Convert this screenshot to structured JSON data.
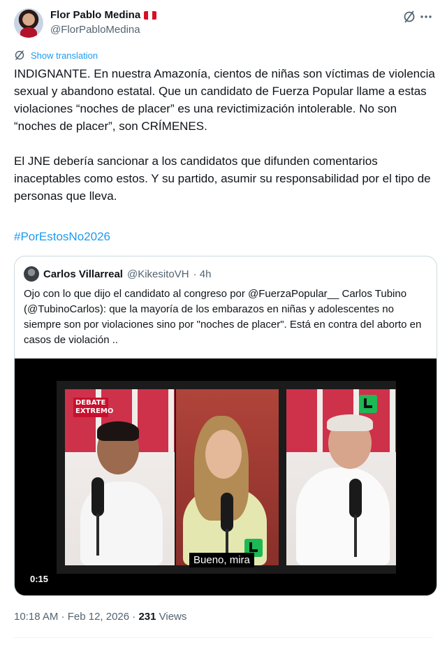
{
  "author": {
    "name": "Flor Pablo Medina",
    "handle": "@FlorPabloMedina",
    "flag_colors": [
      "#d91023",
      "#ffffff",
      "#d91023"
    ]
  },
  "actions": {
    "grok_icon": "grok-slash-circle-icon",
    "more_icon": "more-dots-icon"
  },
  "translate": {
    "label": "Show translation",
    "icon": "globe-slash-icon"
  },
  "tweet": {
    "text": "INDIGNANTE. En nuestra Amazonía, cientos de niñas son víctimas de violencia sexual y abandono estatal. Que un candidato de Fuerza Popular llame a estas violaciones “noches de placer” es una revictimización intolerable. No son “noches de placer”, son CRÍMENES.\n\nEl JNE debería sancionar a los candidatos que difunden comentarios inaceptables como estos. Y su partido, asumir su responsabilidad por el tipo de personas que lleva.",
    "hashtag": "#PorEstosNo2026"
  },
  "quoted": {
    "name": "Carlos Villarreal",
    "handle": "@KikesitoVH",
    "time": "· 4h",
    "text": "Ojo con lo que dijo el candidato al congreso por @FuerzaPopular__ Carlos Tubino (@TubinoCarlos): que la mayoría de los embarazos en niñas y adolescentes no siempre son por violaciones sino por \"noches de placer\". Está en contra del aborto en casos de violación ..",
    "video": {
      "logo_line1": "DEBATE",
      "logo_line2": "EXTREMO",
      "subtitle": "Bueno, mira",
      "timestamp": "0:15"
    }
  },
  "footer": {
    "time": "10:18 AM · Feb 12, 2026 · ",
    "views_count": "231",
    "views_label": " Views"
  },
  "colors": {
    "accent": "#1d9bf0",
    "text": "#0f1419",
    "muted": "#536471"
  }
}
